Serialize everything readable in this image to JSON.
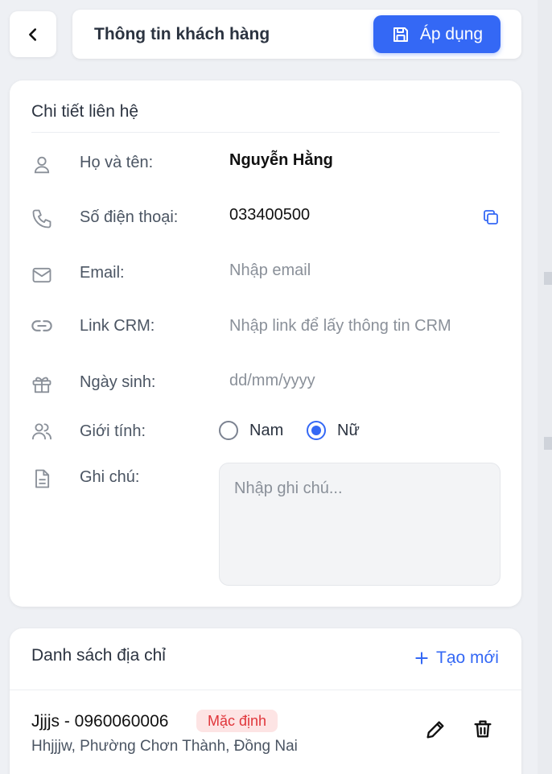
{
  "header": {
    "title": "Thông tin khách hàng",
    "apply_label": "Áp dụng"
  },
  "contact": {
    "section_title": "Chi tiết liên hệ",
    "name_label": "Họ và tên:",
    "name_value": "Nguyễn Hằng",
    "phone_label": "Số điện thoại:",
    "phone_value": "033400500",
    "email_label": "Email:",
    "email_placeholder": "Nhập email",
    "crm_label": "Link CRM:",
    "crm_placeholder": "Nhập link để lấy thông tin CRM",
    "birthday_label": "Ngày sinh:",
    "birthday_placeholder": "dd/mm/yyyy",
    "gender_label": "Giới tính:",
    "gender_options": [
      "Nam",
      "Nữ"
    ],
    "gender_selected": "Nữ",
    "note_label": "Ghi chú:",
    "note_placeholder": "Nhập ghi chú..."
  },
  "addresses": {
    "section_title": "Danh sách địa chỉ",
    "create_label": "Tạo mới",
    "items": [
      {
        "name_phone": "Jjjjs - 0960060006",
        "badge": "Mặc định",
        "address": "Hhjjjw, Phường Chơn Thành, Đồng Nai"
      }
    ]
  },
  "colors": {
    "accent": "#3468f5",
    "badge_bg": "#fde4e4",
    "badge_text": "#e0353a",
    "background": "#eef0f4"
  }
}
